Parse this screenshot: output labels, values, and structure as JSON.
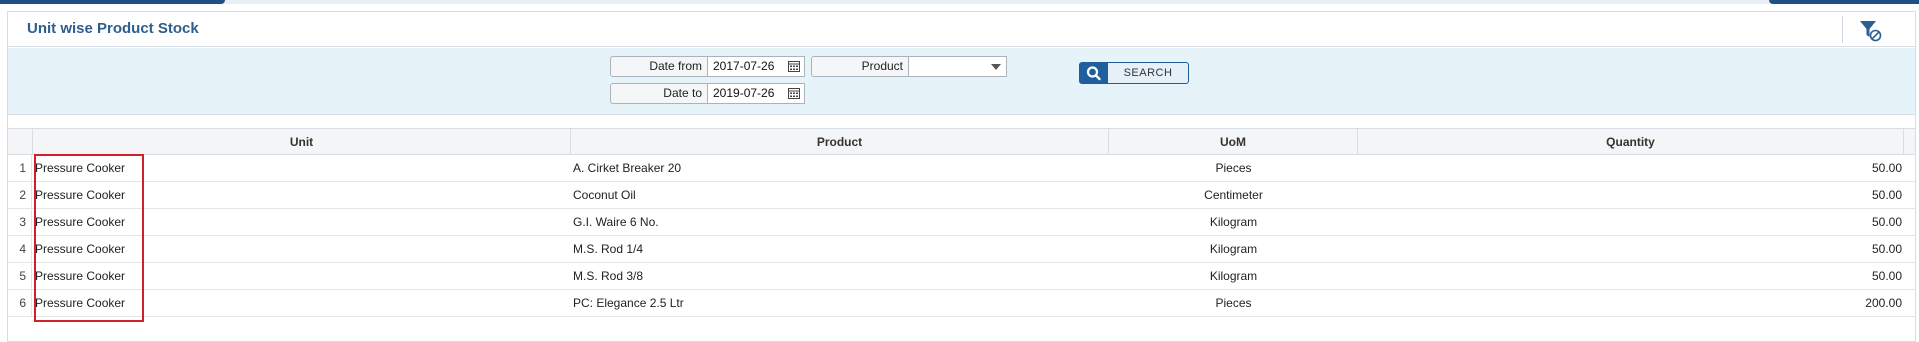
{
  "page": {
    "title": "Unit wise Product Stock"
  },
  "filters": {
    "date_from_label": "Date from",
    "date_from_value": "2017-07-26",
    "date_to_label": "Date to",
    "date_to_value": "2019-07-26",
    "product_label": "Product",
    "product_value": "",
    "search_label": "SEARCH"
  },
  "table": {
    "columns": [
      "Unit",
      "Product",
      "UoM",
      "Quantity"
    ],
    "rows": [
      {
        "n": "1",
        "unit": "Pressure Cooker",
        "product": "A. Cirket Breaker 20",
        "uom": "Pieces",
        "qty": "50.00"
      },
      {
        "n": "2",
        "unit": "Pressure Cooker",
        "product": "Coconut Oil",
        "uom": "Centimeter",
        "qty": "50.00"
      },
      {
        "n": "3",
        "unit": "Pressure Cooker",
        "product": "G.I. Waire 6 No.",
        "uom": "Kilogram",
        "qty": "50.00"
      },
      {
        "n": "4",
        "unit": "Pressure Cooker",
        "product": "M.S. Rod 1/4",
        "uom": "Kilogram",
        "qty": "50.00"
      },
      {
        "n": "5",
        "unit": "Pressure Cooker",
        "product": "M.S. Rod 3/8",
        "uom": "Kilogram",
        "qty": "50.00"
      },
      {
        "n": "6",
        "unit": "Pressure Cooker",
        "product": "PC: Elegance 2.5 Ltr",
        "uom": "Pieces",
        "qty": "200.00"
      }
    ]
  },
  "colors": {
    "accent": "#2c5f8f",
    "filterbar_bg": "#e6f4fa",
    "highlight": "#d0202a"
  },
  "icons": {
    "filter": "filter-clear-icon",
    "search": "search-icon",
    "calendar": "calendar-icon",
    "dropdown": "chevron-down-icon"
  }
}
